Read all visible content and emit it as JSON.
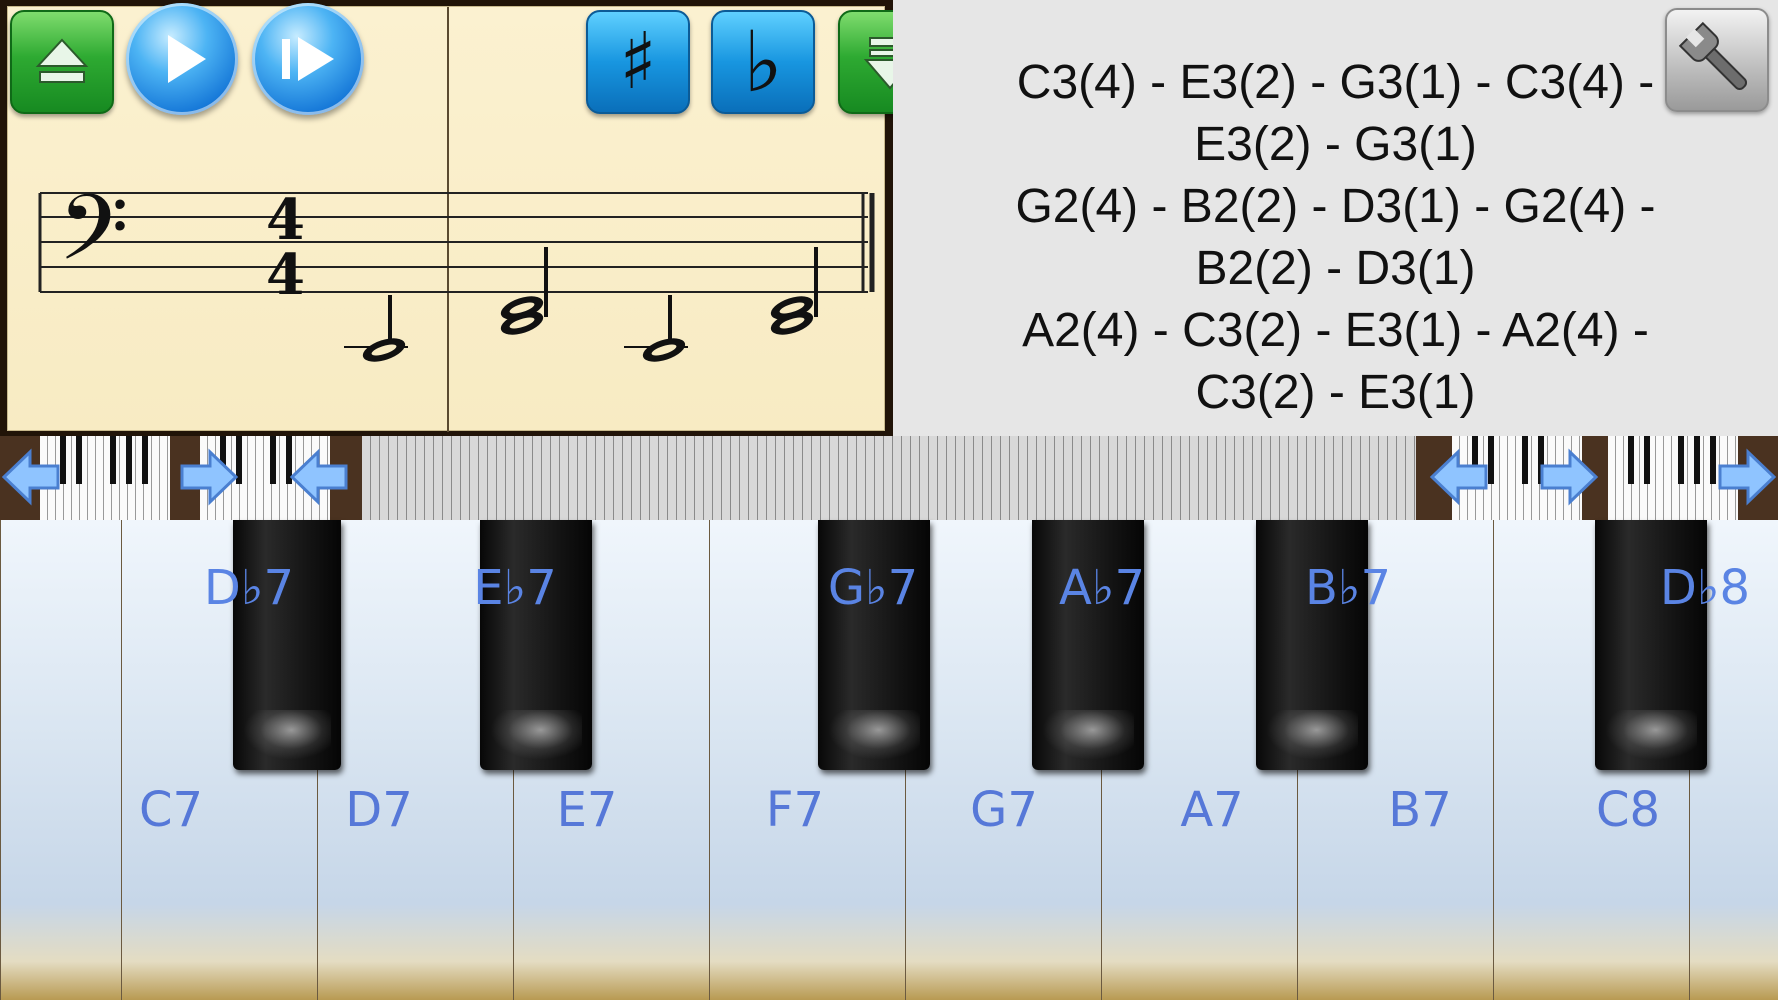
{
  "toolbar": {
    "hide_label": "hide",
    "play_label": "play",
    "step_label": "step",
    "sharp_label": "♯",
    "flat_label": "♭",
    "show_label": "show",
    "settings_label": "settings"
  },
  "sheet": {
    "clef": "𝄢",
    "time_signature_top": "4",
    "time_signature_bottom": "4"
  },
  "chords": {
    "lines": [
      "C3(4) - E3(2) - G3(1) - C3(4) -",
      "E3(2) - G3(1)",
      "G2(4) - B2(2) - D3(1) - G2(4) -",
      "B2(2) - D3(1)",
      "A2(4) - C3(2) - E3(1) - A2(4) -",
      "C3(2) - E3(1)"
    ]
  },
  "piano": {
    "white_keys": [
      "C7",
      "D7",
      "E7",
      "F7",
      "G7",
      "A7",
      "B7",
      "C8"
    ],
    "black_keys": [
      "D♭7",
      "E♭7",
      "G♭7",
      "A♭7",
      "B♭7",
      "D♭8"
    ]
  },
  "icons": {
    "eject": "eject-icon",
    "play": "play-icon",
    "step": "step-icon",
    "sharp": "sharp-icon",
    "flat": "flat-icon",
    "down": "down-icon",
    "wrench": "wrench-icon",
    "arrow_left": "arrow-left-icon",
    "arrow_right": "arrow-right-icon"
  },
  "colors": {
    "accent_green": "#2eaa32",
    "accent_blue": "#1896e0",
    "key_label": "#5678d8",
    "paper": "#f8ebc3"
  }
}
